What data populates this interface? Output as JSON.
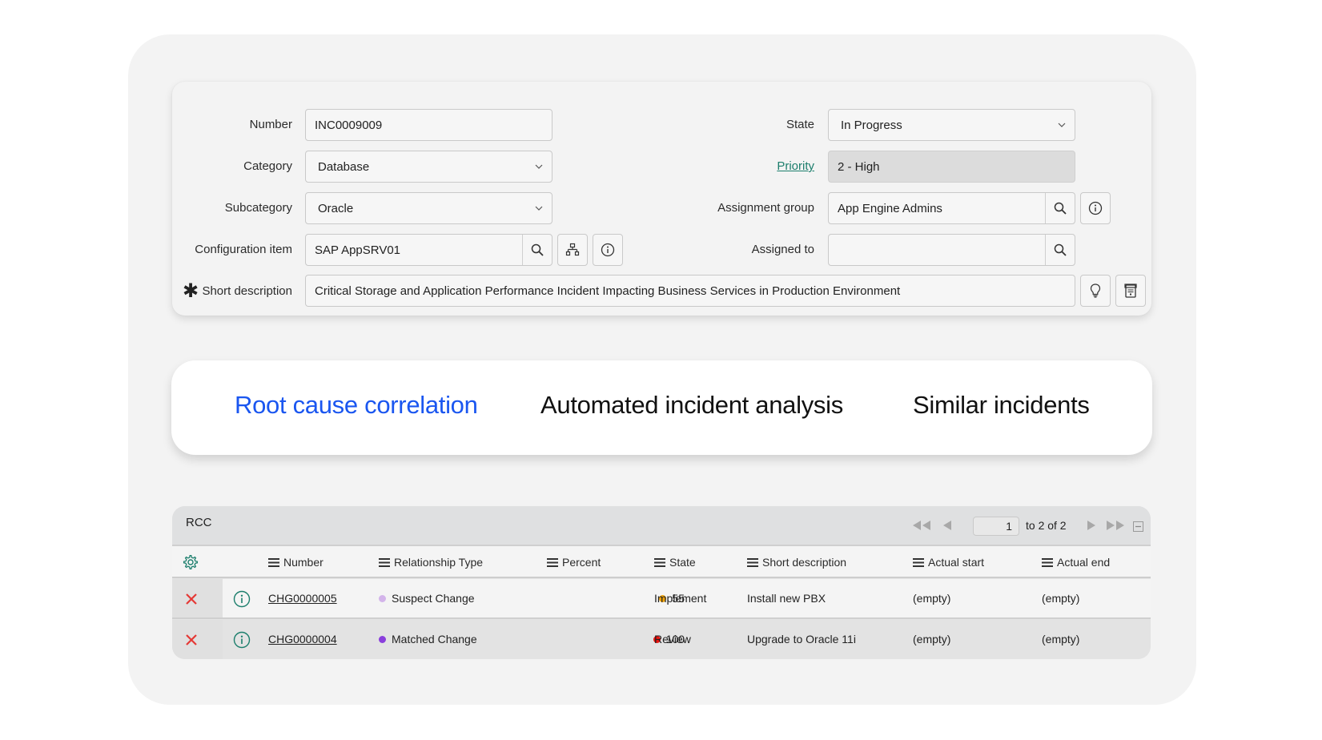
{
  "form": {
    "left": [
      {
        "label": "Number",
        "value": "INC0009009",
        "type": "text"
      },
      {
        "label": "Category",
        "value": "Database",
        "type": "select"
      },
      {
        "label": "Subcategory",
        "value": "Oracle",
        "type": "select"
      },
      {
        "label": "Configuration item",
        "value": "SAP AppSRV01",
        "type": "reference"
      }
    ],
    "right": [
      {
        "label": "State",
        "value": "In Progress",
        "type": "select"
      },
      {
        "label": "Priority",
        "value": "2 - High",
        "type": "readonly",
        "label_is_link": true
      },
      {
        "label": "Assignment group",
        "value": "App Engine Admins",
        "type": "reference"
      },
      {
        "label": "Assigned to",
        "value": "",
        "type": "reference"
      }
    ],
    "short_description": {
      "label": "Short description",
      "required_marker": "✱",
      "value": "Critical Storage and Application Performance Incident Impacting Business Services in Production Environment"
    },
    "icons": {
      "search": "search-icon",
      "dependency": "dependency-map-icon",
      "info": "info-icon",
      "suggestion": "lightbulb-icon",
      "template": "template-icon",
      "chevron": "chevron-down-icon"
    }
  },
  "tabs": [
    {
      "label": "Root cause correlation",
      "active": true
    },
    {
      "label": "Automated incident analysis",
      "active": false
    },
    {
      "label": "Similar incidents",
      "active": false
    }
  ],
  "colors": {
    "active_tab": "#1a56f0",
    "link_teal": "#1c7e6c",
    "delete_red": "#e53935",
    "suspect_dot": "#d3b4ea",
    "matched_dot": "#8a3fdc",
    "percent_55": "#f0a30a",
    "percent_100": "#e8140f"
  },
  "rcc": {
    "title": "RCC",
    "pager": {
      "current": "1",
      "range_text": "to 2 of 2"
    },
    "columns": [
      "Number",
      "Relationship Type",
      "Percent",
      "State",
      "Short description",
      "Actual start",
      "Actual end"
    ],
    "rows": [
      {
        "number": "CHG0000005",
        "relationship_type": "Suspect Change",
        "rel_color": "#d3b4ea",
        "percent": "55",
        "pct_color": "#f0a30a",
        "state": "Implement",
        "short_description": "Install new PBX",
        "actual_start": "(empty)",
        "actual_end": "(empty)"
      },
      {
        "number": "CHG0000004",
        "relationship_type": "Matched Change",
        "rel_color": "#8a3fdc",
        "percent": "100",
        "pct_color": "#e8140f",
        "state": "Review",
        "short_description": "Upgrade to Oracle 11i",
        "actual_start": "(empty)",
        "actual_end": "(empty)"
      }
    ]
  }
}
